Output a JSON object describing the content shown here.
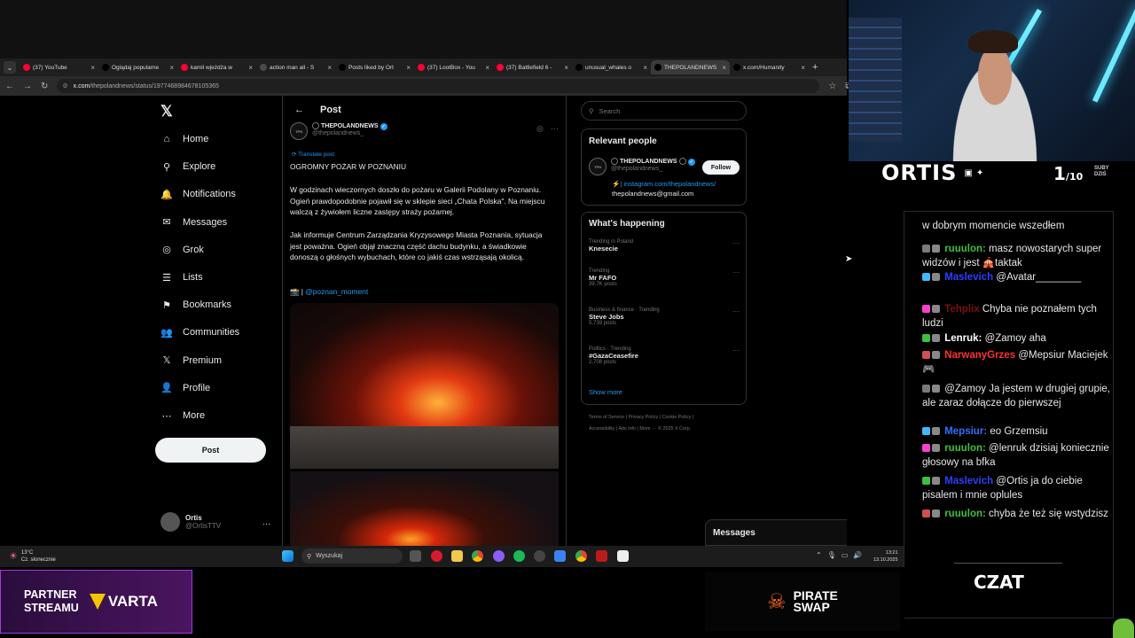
{
  "browser": {
    "tabs": [
      {
        "title": "(37) YouTube",
        "color": "#ff0033"
      },
      {
        "title": "Oglądaj popularne",
        "color": "#000000"
      },
      {
        "title": "kamil wjeżdża w",
        "color": "#ff0033"
      },
      {
        "title": "action man all - S",
        "color": "#4a4a4a"
      },
      {
        "title": "Posts liked by Ort",
        "color": "#000000"
      },
      {
        "title": "(37) LootBox - You",
        "color": "#ff0033"
      },
      {
        "title": "(37) Battlefield 6 -",
        "color": "#ff0033"
      },
      {
        "title": "unusual_whales o",
        "color": "#000000"
      },
      {
        "title": "THEPOLANDNEWS",
        "color": "#000000"
      },
      {
        "title": "x.com/Humanity",
        "color": "#000000"
      }
    ],
    "active_tab": 8,
    "url_domain": "x.com",
    "url_path": "/thepolandnews/status/1977468984678105365",
    "new_tab": "+"
  },
  "sidebar": {
    "logo": "𝕏",
    "items": [
      {
        "label": "Home",
        "icon": "⌂"
      },
      {
        "label": "Explore",
        "icon": "⚲"
      },
      {
        "label": "Notifications",
        "icon": "🔔"
      },
      {
        "label": "Messages",
        "icon": "✉"
      },
      {
        "label": "Grok",
        "icon": "◎"
      },
      {
        "label": "Lists",
        "icon": "☰"
      },
      {
        "label": "Bookmarks",
        "icon": "⚑"
      },
      {
        "label": "Communities",
        "icon": "👥"
      },
      {
        "label": "Premium",
        "icon": "𝕏"
      },
      {
        "label": "Profile",
        "icon": "👤"
      },
      {
        "label": "More",
        "icon": "⋯"
      }
    ],
    "post_button": "Post",
    "user": {
      "name": "Ortis",
      "handle": "@OrtisTTV"
    },
    "user_menu": "···"
  },
  "post": {
    "header": "Post",
    "back": "←",
    "author_name": "THEPOLANDNEWS",
    "author_handle": "@thepolandnews_",
    "logo_text": "TPN",
    "translate": "Translate post",
    "headline": "OGROMNY POŻAR W POZNANIU",
    "paragraph1": "W godzinach wieczornych doszło do pożaru w Galerii Podolany w Poznaniu. Ogień prawdopodobnie pojawił się w sklepie sieci „Chata Polska\". Na miejscu walczą z żywiołem liczne zastępy straży pożarnej.",
    "paragraph2": "Jak informuje Centrum Zarządzania Kryzysowego Miasta Poznania, sytuacja jest poważna. Ogień objął znaczną część dachu budynku, a świadkowie donoszą o głośnych wybuchach, które co jakiś czas wstrząsają okolicą.",
    "source_prefix": "📸 | ",
    "source_link": "@poznan_moment"
  },
  "right": {
    "search_placeholder": "Search",
    "relevant_title": "Relevant people",
    "relevant_name": "THEPOLANDNEWS",
    "relevant_handle": "@thepolandnews_",
    "follow": "Follow",
    "bio_line1": "⚡| instagram.com/thepolandnews/",
    "bio_line2": "thepolandnews@gmail.com",
    "happening_title": "What's happening",
    "trends": [
      {
        "category": "Trending in Poland",
        "name": "Knesecie",
        "count": ""
      },
      {
        "category": "Trending",
        "name": "Mr FAFO",
        "count": "39.7K posts"
      },
      {
        "category": "Business & finance · Trending",
        "name": "Steve Jobs",
        "count": "5,739 posts"
      },
      {
        "category": "Politics · Trending",
        "name": "#GazaCeasefire",
        "count": "2,708 posts"
      }
    ],
    "show_more": "Show more",
    "footer_line1": "Terms of Service  |  Privacy Policy  |  Cookie Policy  |",
    "footer_line2": "Accessibility  |  Ads info  |  More ···  © 2025 X Corp.",
    "messages": "Messages"
  },
  "taskbar": {
    "temp": "13°C",
    "weather": "Cz. słonecznie",
    "search": "Wyszukaj",
    "time": "13:21",
    "date": "13.10.2025"
  },
  "stream": {
    "name": "ORTIS",
    "subs_count": "1",
    "subs_goal": "/10",
    "subs_label1": "SUBY",
    "subs_label2": "DZIŚ",
    "chat_title": "CZAT",
    "chat": [
      {
        "user": "",
        "color": "#ffffff",
        "text": "w dobrym momencie wszedłem"
      },
      {
        "user": "ruuulon:",
        "color": "#3fbf3f",
        "text": "masz nowostarych super widzów i jest 🎪taktak"
      },
      {
        "user": "Maslevich",
        "color": "#2f3fff",
        "text": "@Avatar________"
      },
      {
        "user": "Tehplix",
        "color": "#7a1010",
        "text": "Chyba nie poznałem tych ludzi"
      },
      {
        "user": "Lenruk:",
        "color": "#ffffff",
        "text": "@Zamoy aha"
      },
      {
        "user": "NarwanyGrzes",
        "color": "#ff3030",
        "text": "@Mepsiur Maciejek 🎮"
      },
      {
        "user": "",
        "color": "#ffffff",
        "text": "@Zamoy Ja jestem w drugiej grupie, ale zaraz dołącze do pierwszej"
      },
      {
        "user": "Mepsiur:",
        "color": "#2f6fff",
        "text": "eo Grzemsiu"
      },
      {
        "user": "ruuulon:",
        "color": "#3fbf3f",
        "text": "@lenruk dzisiaj koniecznie głosowy na bfka"
      },
      {
        "user": "Maslevich",
        "color": "#2f3fff",
        "text": "@Ortis ja do ciebie pisalem i mnie oplules"
      },
      {
        "user": "ruuulon:",
        "color": "#3fbf3f",
        "text": "chyba że też się wstydzisz"
      }
    ],
    "sponsor1_line1": "PARTNER",
    "sponsor1_line2": "STREAMU",
    "sponsor1_brand": "VARTA",
    "sponsor2_line1": "PIRATE",
    "sponsor2_line2": "SWAP"
  }
}
